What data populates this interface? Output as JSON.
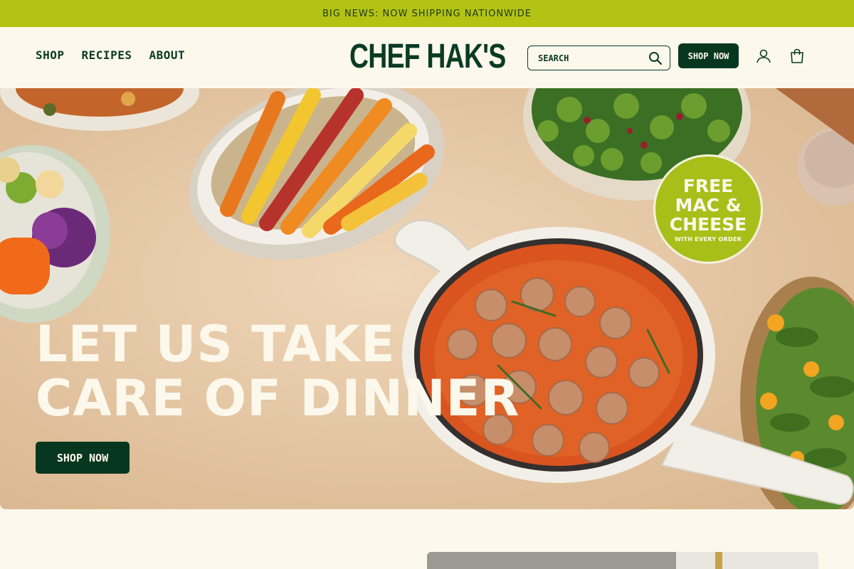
{
  "announcement": "BIG NEWS: NOW SHIPPING NATIONWIDE",
  "nav": {
    "shop": "SHOP",
    "recipes": "RECIPES",
    "about": "ABOUT"
  },
  "logo": "CHEF HAK'S",
  "search": {
    "placeholder": "SEARCH",
    "icon": "search-icon"
  },
  "header_button": "SHOP NOW",
  "icons": {
    "account": "account-icon",
    "cart": "cart-icon"
  },
  "hero": {
    "title_line1": "LET US TAKE",
    "title_line2": "CARE OF DINNER",
    "button": "SHOP NOW",
    "badge_main": "FREE\nMAC &\nCHEESE",
    "badge_sub": "WITH EVERY ORDER"
  },
  "colors": {
    "announcement_bg": "#b3c314",
    "brand_green": "#083720",
    "page_bg": "#fdf8ec",
    "badge_green": "#a8bf1a"
  }
}
